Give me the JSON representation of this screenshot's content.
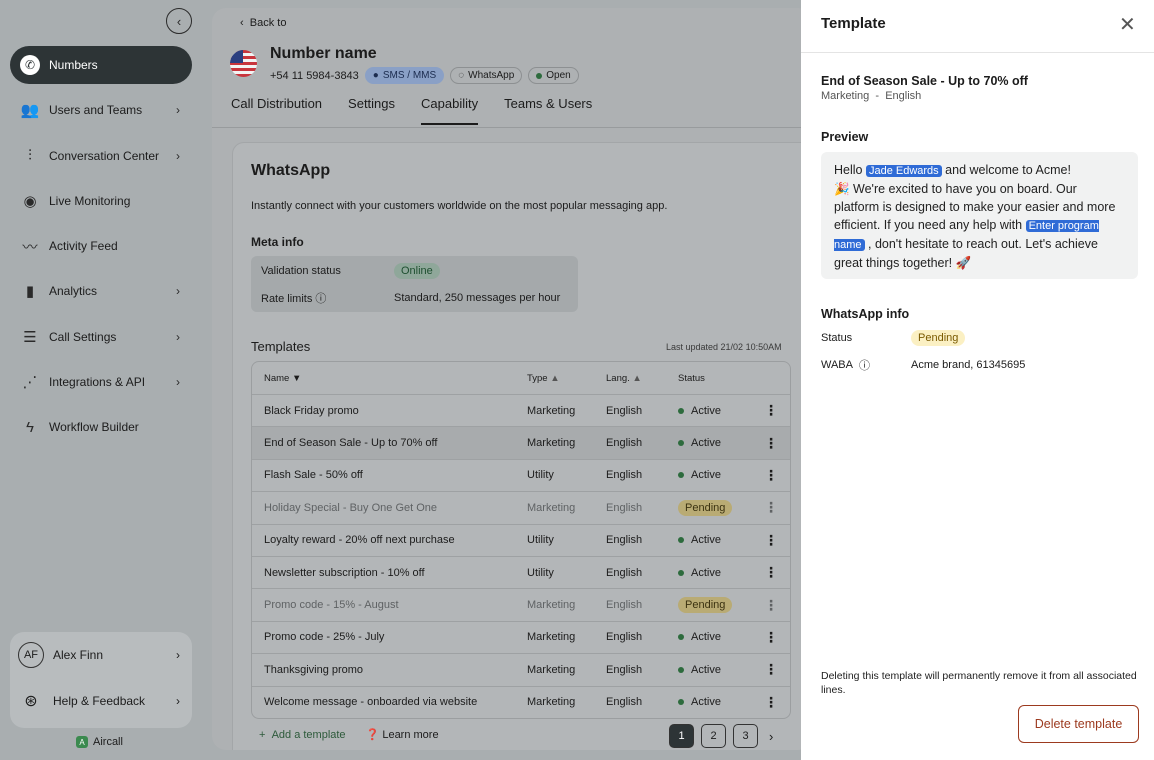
{
  "sidebar": {
    "items": [
      {
        "label": "Numbers",
        "icon": "phone-icon"
      },
      {
        "label": "Users and Teams",
        "icon": "users-icon"
      },
      {
        "label": "Conversation Center",
        "icon": "waveform-icon"
      },
      {
        "label": "Live Monitoring",
        "icon": "monitor-icon"
      },
      {
        "label": "Activity Feed",
        "icon": "pulse-icon"
      },
      {
        "label": "Analytics",
        "icon": "bar-chart-icon"
      },
      {
        "label": "Call Settings",
        "icon": "sliders-icon"
      },
      {
        "label": "Integrations & API",
        "icon": "integrations-icon"
      },
      {
        "label": "Workflow Builder",
        "icon": "bolt-icon"
      }
    ],
    "user": {
      "initials": "AF",
      "name": "Alex Finn"
    },
    "help": "Help & Feedback",
    "brand": "Aircall"
  },
  "header": {
    "back": "Back to",
    "title": "Number name",
    "phone": "+54 11 5984-3843",
    "chips": {
      "sms": "SMS / MMS",
      "whatsapp": "WhatsApp",
      "open": "Open"
    }
  },
  "tabs": [
    "Call Distribution",
    "Settings",
    "Capability",
    "Teams & Users"
  ],
  "whatsapp": {
    "title": "WhatsApp",
    "description": "Instantly connect with your customers worldwide on the most popular messaging app.",
    "meta_title": "Meta info",
    "validation_label": "Validation status",
    "validation_value": "Online",
    "rate_label": "Rate limits",
    "rate_value": "Standard, 250 messages per hour"
  },
  "templates": {
    "title": "Templates",
    "updated": "Last updated 21/02 10:50AM",
    "columns": {
      "name": "Name",
      "type": "Type",
      "lang": "Lang.",
      "status": "Status"
    },
    "rows": [
      {
        "name": "Black Friday promo",
        "type": "Marketing",
        "lang": "English",
        "status": "Active"
      },
      {
        "name": "End of Season Sale - Up to 70% off",
        "type": "Marketing",
        "lang": "English",
        "status": "Active"
      },
      {
        "name": "Flash Sale - 50% off",
        "type": "Utility",
        "lang": "English",
        "status": "Active"
      },
      {
        "name": "Holiday Special - Buy One Get One",
        "type": "Marketing",
        "lang": "English",
        "status": "Pending"
      },
      {
        "name": "Loyalty reward - 20% off next purchase",
        "type": "Utility",
        "lang": "English",
        "status": "Active"
      },
      {
        "name": "Newsletter subscription - 10% off",
        "type": "Utility",
        "lang": "English",
        "status": "Active"
      },
      {
        "name": "Promo code - 15% - August",
        "type": "Marketing",
        "lang": "English",
        "status": "Pending"
      },
      {
        "name": "Promo code - 25% - July",
        "type": "Marketing",
        "lang": "English",
        "status": "Active"
      },
      {
        "name": "Thanksgiving promo",
        "type": "Marketing",
        "lang": "English",
        "status": "Active"
      },
      {
        "name": "Welcome message - onboarded via website",
        "type": "Marketing",
        "lang": "English",
        "status": "Active"
      }
    ],
    "add": "Add a template",
    "learn": "Learn more",
    "pages": [
      "1",
      "2",
      "3"
    ]
  },
  "panel": {
    "title": "Template",
    "name": "End of Season Sale - Up to 70% off",
    "category": "Marketing",
    "separator": "-",
    "language": "English",
    "preview_title": "Preview",
    "preview": {
      "p1": "Hello ",
      "var1": "Jade Edwards",
      "p2": " and welcome to Acme!",
      "p3": "🎉 We're excited to have you on board. Our platform is designed to make your easier and more efficient. If you need any help with ",
      "var2": "Enter program name",
      "p4": " , don't hesitate to reach out. Let's achieve great things together! 🚀"
    },
    "wa_title": "WhatsApp info",
    "status_label": "Status",
    "status_value": "Pending",
    "waba_label": "WABA",
    "waba_value": "Acme brand, 61345695",
    "warning": "Deleting this template will permanently remove it from all associated lines.",
    "delete": "Delete template"
  }
}
